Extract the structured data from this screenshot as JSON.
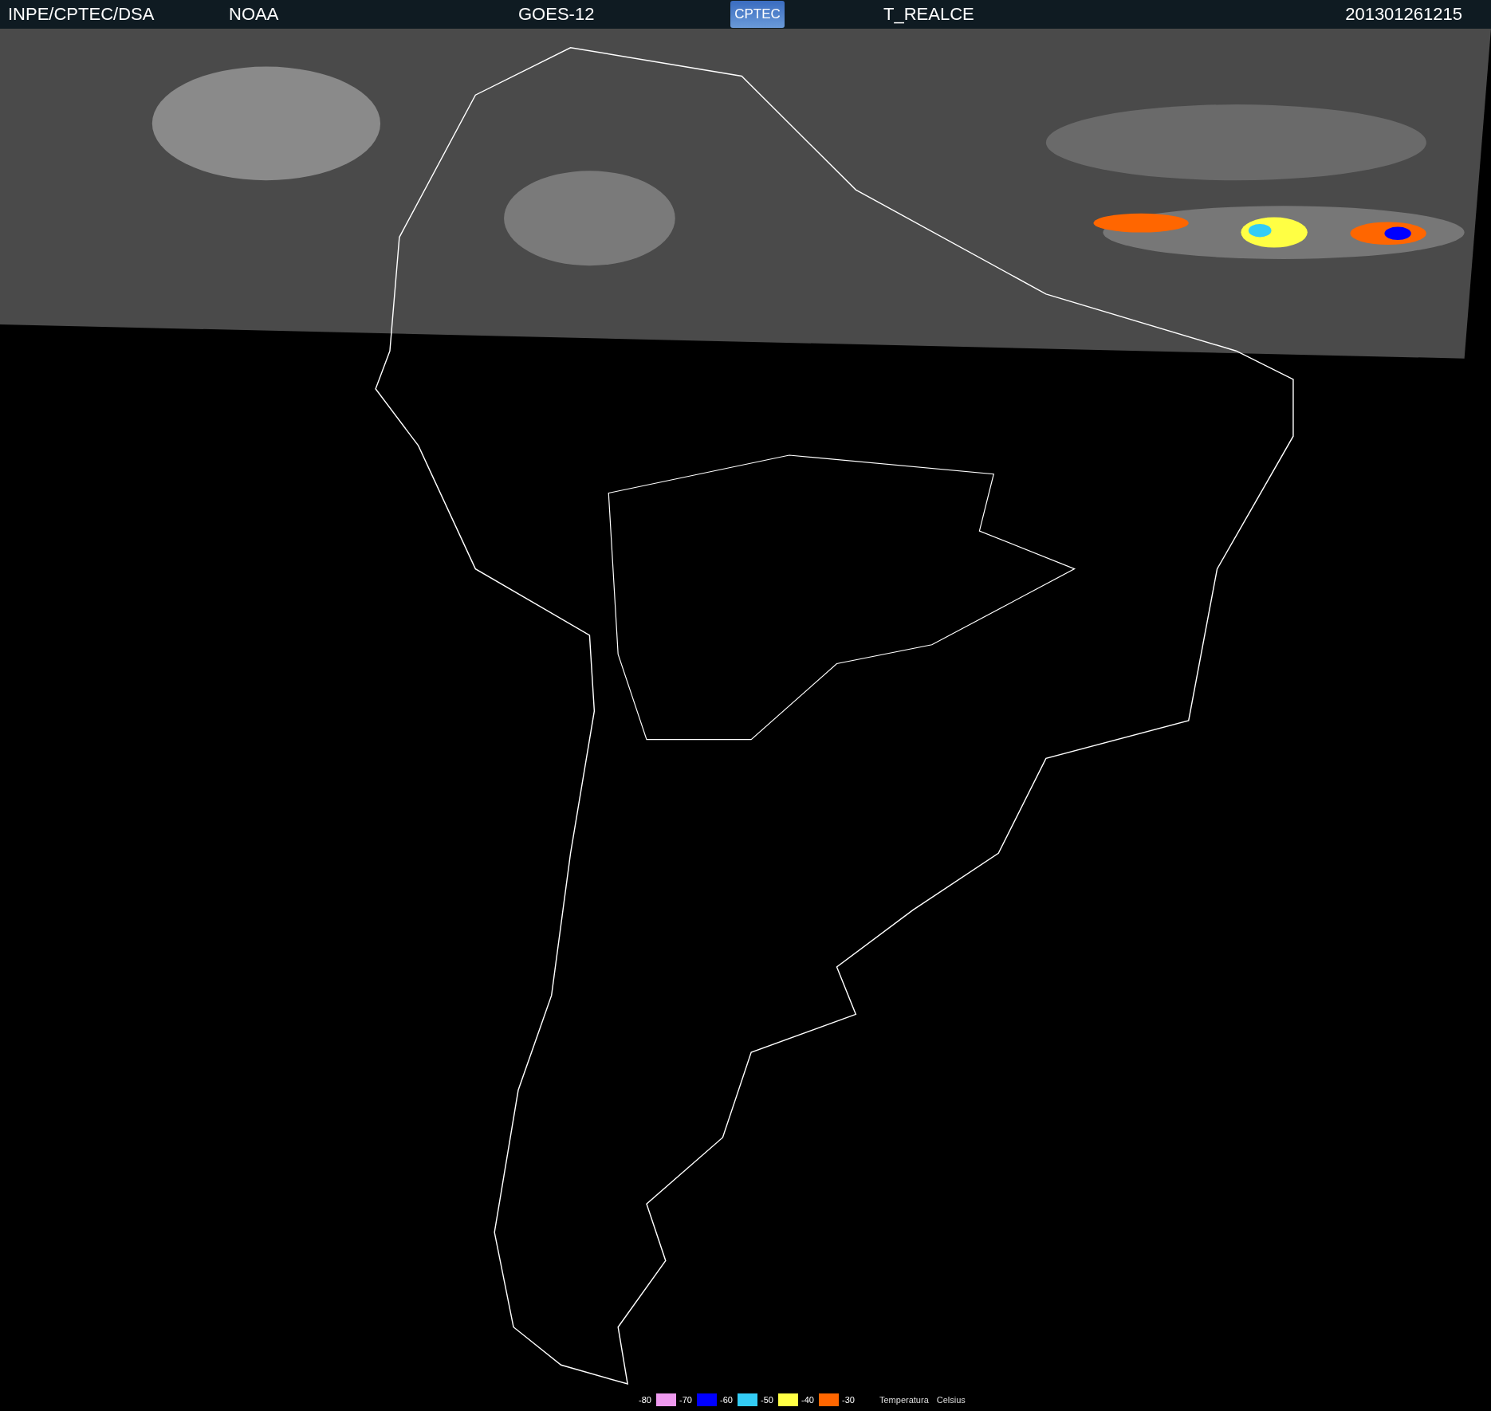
{
  "header": {
    "items": [
      "INPE/CPTEC/DSA",
      "NOAA",
      "GOES-12"
    ],
    "logo": "CPTEC",
    "product": "T_REALCE",
    "timestamp": "201301261215"
  },
  "legend": {
    "scale": [
      {
        "label": "-80",
        "color": "#ee99ee"
      },
      {
        "label": "-70",
        "color": "#0000ff"
      },
      {
        "label": "-60",
        "color": "#33ccf5"
      },
      {
        "label": "-50",
        "color": "#ffff44"
      },
      {
        "label": "-40",
        "color": "#ff6600"
      },
      {
        "label": "-30"
      }
    ],
    "title": "Temperatura",
    "unit": "Celsius"
  }
}
